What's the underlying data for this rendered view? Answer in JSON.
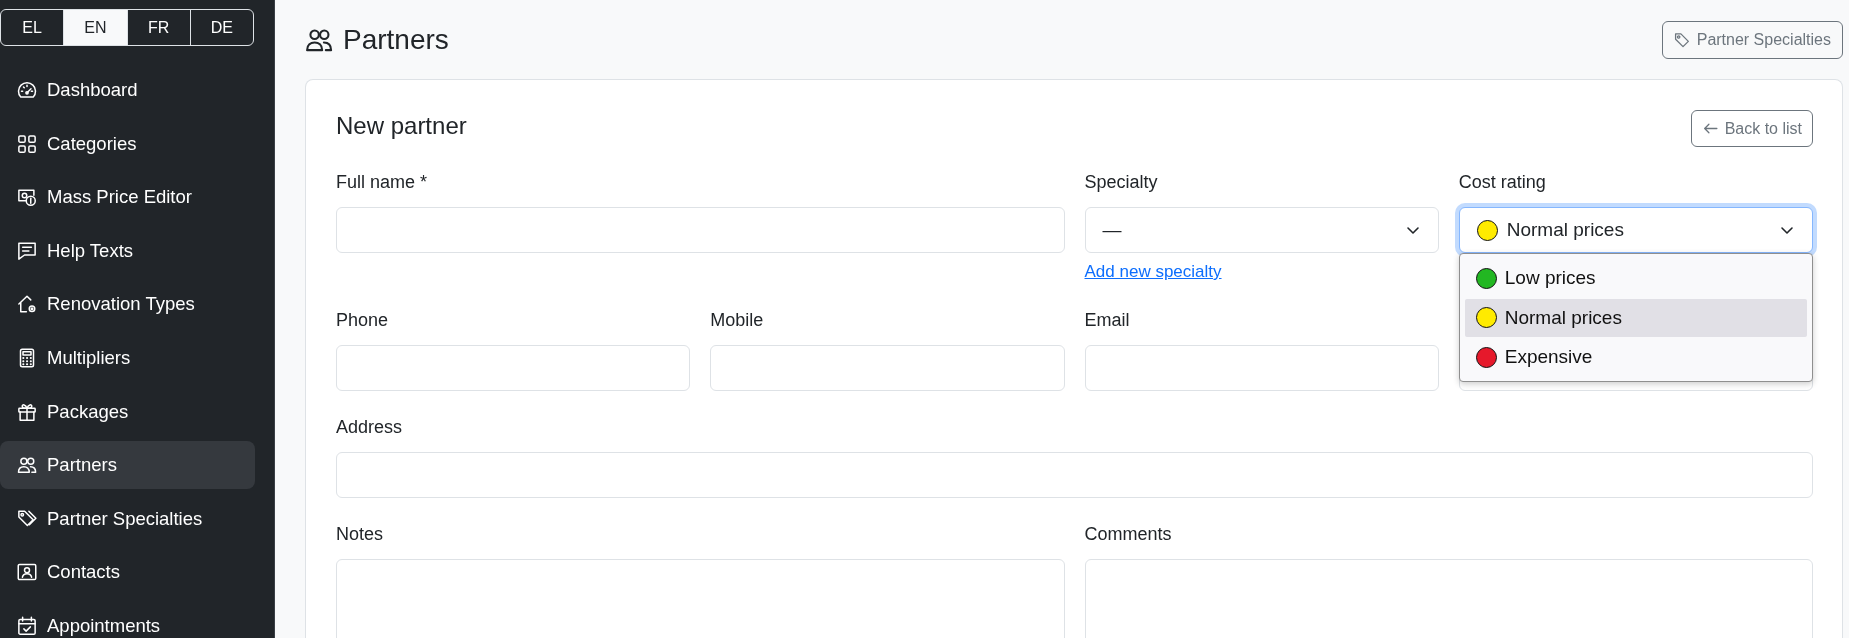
{
  "language_switcher": [
    {
      "label": "EL",
      "selected": false
    },
    {
      "label": "EN",
      "selected": true
    },
    {
      "label": "FR",
      "selected": false
    },
    {
      "label": "DE",
      "selected": false
    }
  ],
  "sidebar": {
    "items": [
      {
        "label": "Dashboard",
        "selected": false
      },
      {
        "label": "Categories",
        "selected": false
      },
      {
        "label": "Mass Price Editor",
        "selected": false
      },
      {
        "label": "Help Texts",
        "selected": false
      },
      {
        "label": "Renovation Types",
        "selected": false
      },
      {
        "label": "Multipliers",
        "selected": false
      },
      {
        "label": "Packages",
        "selected": false
      },
      {
        "label": "Partners",
        "selected": true
      },
      {
        "label": "Partner Specialties",
        "selected": false
      },
      {
        "label": "Contacts",
        "selected": false
      },
      {
        "label": "Appointments",
        "selected": false
      }
    ]
  },
  "header": {
    "title": "Partners",
    "button": "Partner Specialties"
  },
  "form": {
    "title": "New partner",
    "back_button": "Back to list",
    "rows": [
      {
        "fields": [
          {
            "label": "Full name *",
            "kind": "text",
            "focused": false
          },
          {
            "label": "Specialty",
            "kind": "select",
            "value": "—",
            "focused": false,
            "link": "Add new specialty"
          },
          {
            "label": "Cost rating",
            "kind": "select",
            "value": "Normal prices",
            "color": "#ffeb00",
            "focused": true,
            "expanded": true,
            "options": [
              {
                "label": "Low prices",
                "color": "#22b722",
                "selected": false
              },
              {
                "label": "Normal prices",
                "color": "#ffeb00",
                "selected": true
              },
              {
                "label": "Expensive",
                "color": "#e6192b",
                "selected": false
              }
            ]
          }
        ]
      },
      {
        "fields": [
          {
            "label": "Phone",
            "kind": "text",
            "focused": false
          },
          {
            "label": "Mobile",
            "kind": "text",
            "focused": false
          },
          {
            "label": "Email",
            "kind": "text",
            "focused": false
          },
          {
            "kind": "text",
            "focused": false
          }
        ]
      },
      {
        "fields": [
          {
            "label": "Address",
            "kind": "text",
            "focused": false
          }
        ]
      },
      {
        "fields": [
          {
            "label": "Notes",
            "kind": "textarea",
            "focused": false
          },
          {
            "label": "Comments",
            "kind": "textarea",
            "focused": false
          }
        ]
      }
    ]
  }
}
